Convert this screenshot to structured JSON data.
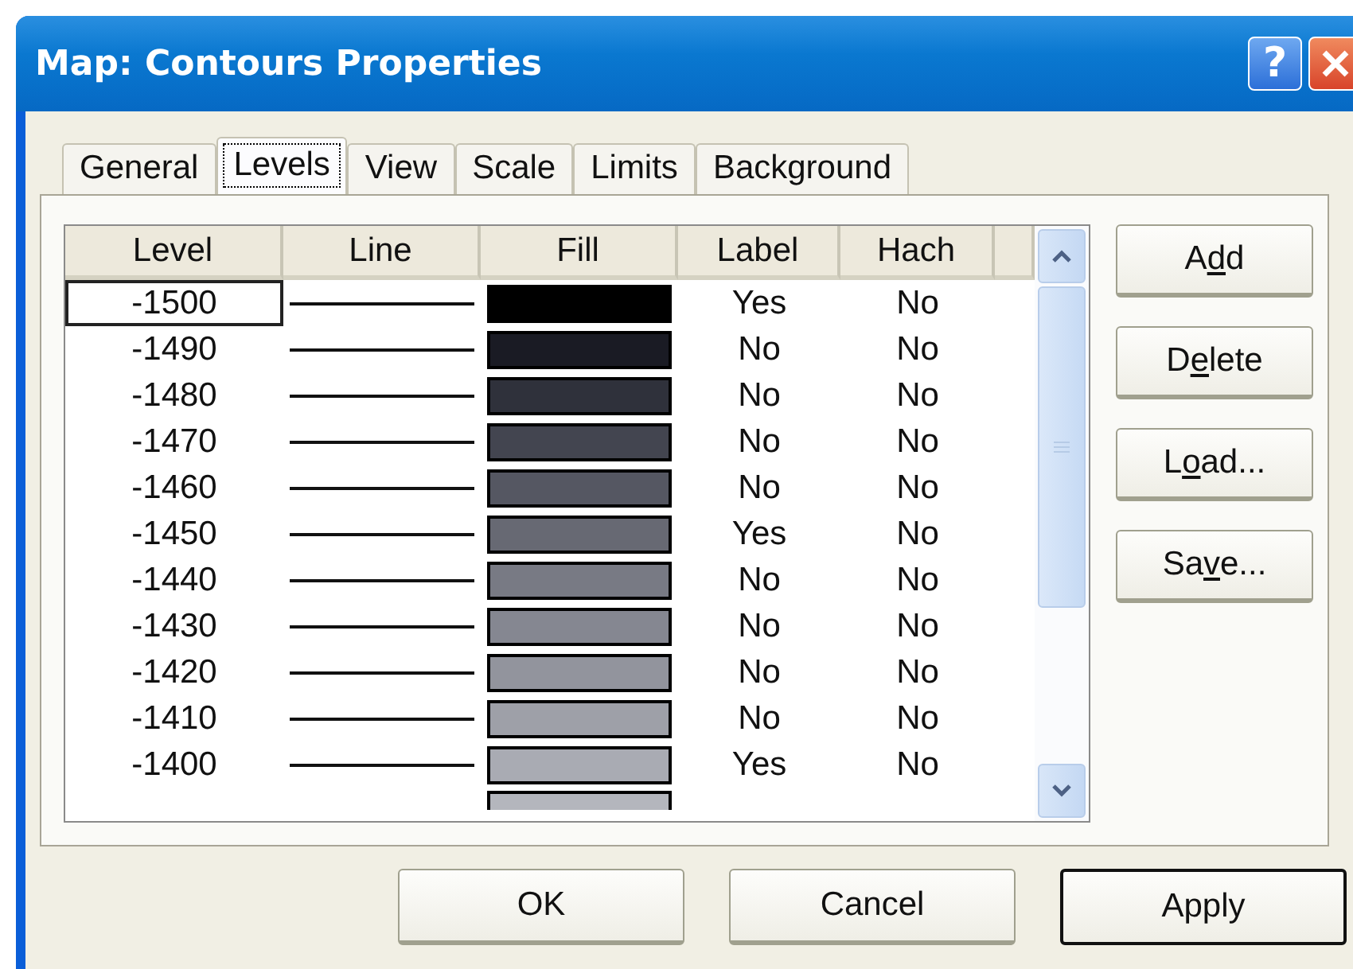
{
  "window": {
    "title": "Map: Contours Properties",
    "help_button": "?"
  },
  "tabs": [
    {
      "label": "General",
      "selected": false
    },
    {
      "label": "Levels",
      "selected": true
    },
    {
      "label": "View",
      "selected": false
    },
    {
      "label": "Scale",
      "selected": false
    },
    {
      "label": "Limits",
      "selected": false
    },
    {
      "label": "Background",
      "selected": false
    }
  ],
  "table": {
    "columns": [
      "Level",
      "Line",
      "Fill",
      "Label",
      "Hach"
    ],
    "rows": [
      {
        "level": "-1500",
        "color": "#000000",
        "label": "Yes",
        "hach": "No",
        "selected": true
      },
      {
        "level": "-1490",
        "color": "#1a1b24",
        "label": "No",
        "hach": "No",
        "selected": false
      },
      {
        "level": "-1480",
        "color": "#2f313b",
        "label": "No",
        "hach": "No",
        "selected": false
      },
      {
        "level": "-1470",
        "color": "#434550",
        "label": "No",
        "hach": "No",
        "selected": false
      },
      {
        "level": "-1460",
        "color": "#555762",
        "label": "No",
        "hach": "No",
        "selected": false
      },
      {
        "level": "-1450",
        "color": "#676973",
        "label": "Yes",
        "hach": "No",
        "selected": false
      },
      {
        "level": "-1440",
        "color": "#787a84",
        "label": "No",
        "hach": "No",
        "selected": false
      },
      {
        "level": "-1430",
        "color": "#858791",
        "label": "No",
        "hach": "No",
        "selected": false
      },
      {
        "level": "-1420",
        "color": "#92949d",
        "label": "No",
        "hach": "No",
        "selected": false
      },
      {
        "level": "-1410",
        "color": "#9ea0a8",
        "label": "No",
        "hach": "No",
        "selected": false
      },
      {
        "level": "-1400",
        "color": "#a9abb3",
        "label": "Yes",
        "hach": "No",
        "selected": false
      }
    ],
    "clipped_row": {
      "color": "#b4b6bd"
    }
  },
  "side_buttons": [
    {
      "before": "A",
      "key": "d",
      "after": "d"
    },
    {
      "before": "D",
      "key": "e",
      "after": "lete"
    },
    {
      "before": "L",
      "key": "o",
      "after": "ad..."
    },
    {
      "before": "Sa",
      "key": "v",
      "after": "e..."
    }
  ],
  "footer_buttons": [
    {
      "label": "OK",
      "default": false
    },
    {
      "label": "Cancel",
      "default": false
    },
    {
      "label": "Apply",
      "default": true
    }
  ]
}
